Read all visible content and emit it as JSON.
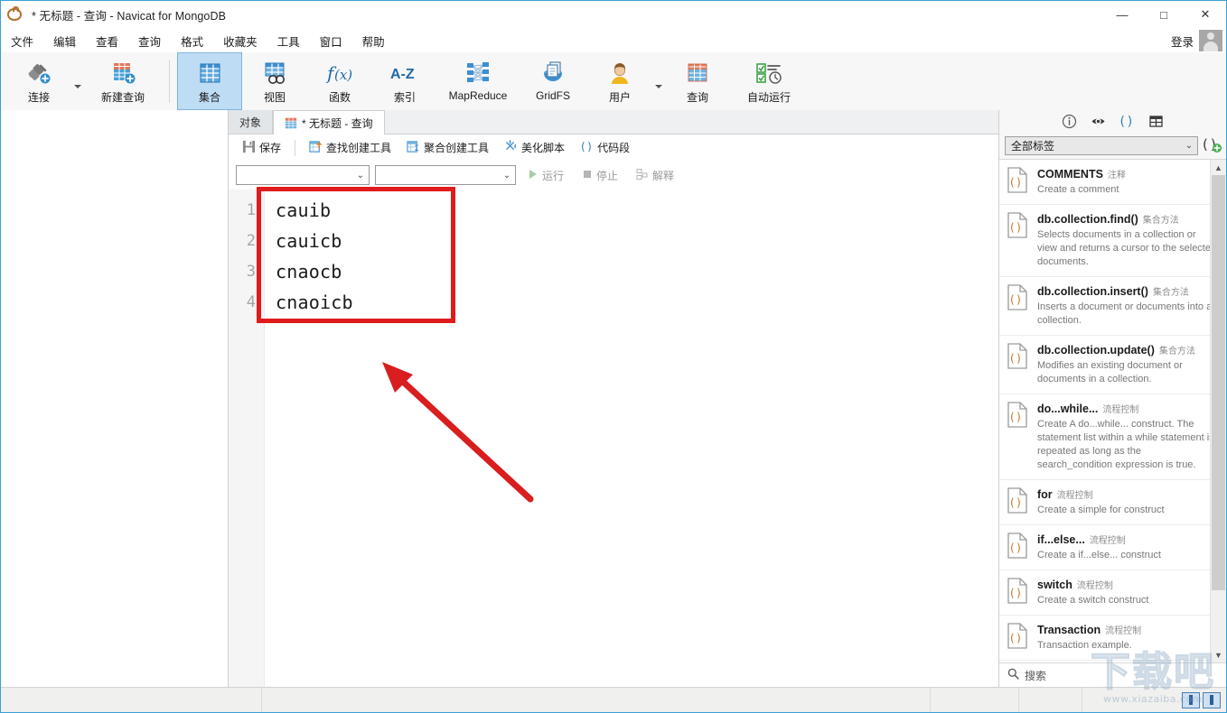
{
  "window": {
    "title": "* 无标题 - 查询 - Navicat for MongoDB",
    "logo_icon": "navicat-logo-icon",
    "minimize": "—",
    "maximize": "□",
    "close": "✕"
  },
  "menubar": {
    "items": [
      {
        "label": "文件",
        "name": "menu-file"
      },
      {
        "label": "编辑",
        "name": "menu-edit"
      },
      {
        "label": "查看",
        "name": "menu-view"
      },
      {
        "label": "查询",
        "name": "menu-query"
      },
      {
        "label": "格式",
        "name": "menu-format"
      },
      {
        "label": "收藏夹",
        "name": "menu-favorites"
      },
      {
        "label": "工具",
        "name": "menu-tools"
      },
      {
        "label": "窗口",
        "name": "menu-window"
      },
      {
        "label": "帮助",
        "name": "menu-help"
      }
    ],
    "login_label": "登录",
    "avatar_icon": "avatar-icon"
  },
  "toolbar": {
    "groups": [
      {
        "buttons": [
          {
            "label": "连接",
            "icon": "connection-icon",
            "name": "toolbar-connection",
            "caret": true,
            "active": false
          },
          {
            "label": "新建查询",
            "icon": "new-query-icon",
            "name": "toolbar-new-query",
            "caret": false,
            "active": false
          }
        ]
      },
      {
        "buttons": [
          {
            "label": "集合",
            "icon": "collection-icon",
            "name": "toolbar-collection",
            "caret": false,
            "active": true
          },
          {
            "label": "视图",
            "icon": "view-icon",
            "name": "toolbar-view",
            "caret": false,
            "active": false
          },
          {
            "label": "函数",
            "icon": "function-icon",
            "name": "toolbar-function",
            "caret": false,
            "active": false
          },
          {
            "label": "索引",
            "icon": "index-icon",
            "name": "toolbar-index",
            "caret": false,
            "active": false
          },
          {
            "label": "MapReduce",
            "icon": "mapreduce-icon",
            "name": "toolbar-mapreduce",
            "caret": false,
            "active": false
          },
          {
            "label": "GridFS",
            "icon": "gridfs-icon",
            "name": "toolbar-gridfs",
            "caret": false,
            "active": false
          },
          {
            "label": "用户",
            "icon": "user-icon",
            "name": "toolbar-user",
            "caret": true,
            "active": false
          },
          {
            "label": "查询",
            "icon": "query-icon",
            "name": "toolbar-query",
            "caret": false,
            "active": false
          },
          {
            "label": "自动运行",
            "icon": "automation-icon",
            "name": "toolbar-automation",
            "caret": false,
            "active": false
          }
        ]
      }
    ]
  },
  "tabs": [
    {
      "label": "对象",
      "name": "tab-objects",
      "active": false,
      "icon": null
    },
    {
      "label": "* 无标题 - 查询",
      "name": "tab-untitled-query",
      "active": true,
      "icon": "query-tab-icon"
    }
  ],
  "query_toolbar": {
    "items": [
      {
        "label": "保存",
        "icon": "save-icon",
        "name": "save-button",
        "disabled": false,
        "sep_after": true
      },
      {
        "label": "查找创建工具",
        "icon": "find-builder-icon",
        "name": "find-builder-button",
        "disabled": false,
        "sep_after": false
      },
      {
        "label": "聚合创建工具",
        "icon": "aggregate-builder-icon",
        "name": "aggregate-builder-button",
        "disabled": false,
        "sep_after": false
      },
      {
        "label": "美化脚本",
        "icon": "beautify-icon",
        "name": "beautify-script-button",
        "disabled": false,
        "sep_after": false
      },
      {
        "label": "代码段",
        "icon": "snippet-icon",
        "name": "code-snippet-button",
        "disabled": false,
        "sep_after": false
      }
    ],
    "run_items": [
      {
        "label": "运行",
        "icon": "run-icon",
        "name": "run-button"
      },
      {
        "label": "停止",
        "icon": "stop-icon",
        "name": "stop-button"
      },
      {
        "label": "解释",
        "icon": "explain-icon",
        "name": "explain-button"
      }
    ]
  },
  "combos": [
    {
      "value": "",
      "placeholder": "",
      "name": "connection-select"
    },
    {
      "value": "",
      "placeholder": "",
      "name": "database-select"
    }
  ],
  "editor": {
    "lines": [
      {
        "number": "1",
        "text": "cauib"
      },
      {
        "number": "2",
        "text": "cauicb"
      },
      {
        "number": "3",
        "text": "cnaocb"
      },
      {
        "number": "4",
        "text": "cnaoicb"
      }
    ]
  },
  "annotations": {
    "box_color": "#e01b1b",
    "arrow_color": "#d81e1e"
  },
  "right_panel": {
    "icons": [
      {
        "name": "info-icon",
        "glyph": "ⓘ",
        "active": false
      },
      {
        "name": "eye-icon",
        "glyph": "◉",
        "active": false
      },
      {
        "name": "code-snippet-icon",
        "glyph": "( )",
        "active": true
      },
      {
        "name": "table-grid-icon",
        "glyph": "▦",
        "active": false
      }
    ],
    "filter_label": "全部标签",
    "add_snippet_icon": "add-snippet-icon",
    "snippets": [
      {
        "title": "COMMENTS",
        "category": "注释",
        "desc": "Create a comment"
      },
      {
        "title": "db.collection.find()",
        "category": "集合方法",
        "desc": "Selects documents in a collection or view and returns a cursor to the selected documents."
      },
      {
        "title": "db.collection.insert()",
        "category": "集合方法",
        "desc": "Inserts a document or documents into a collection."
      },
      {
        "title": "db.collection.update()",
        "category": "集合方法",
        "desc": "Modifies an existing document or documents in a collection."
      },
      {
        "title": "do...while...",
        "category": "流程控制",
        "desc": "Create A do...while... construct. The statement list within a while statement is repeated as long as the search_condition expression is true."
      },
      {
        "title": "for",
        "category": "流程控制",
        "desc": "Create a simple for construct"
      },
      {
        "title": "if...else...",
        "category": "流程控制",
        "desc": "Create a if...else... construct"
      },
      {
        "title": "switch",
        "category": "流程控制",
        "desc": "Create a switch construct"
      },
      {
        "title": "Transaction",
        "category": "流程控制",
        "desc": "Transaction example."
      }
    ],
    "search_placeholder": "搜索",
    "search_icon": "search-icon",
    "scroll_up_icon": "chevron-up-icon",
    "scroll_down_icon": "chevron-down-icon"
  },
  "statusbar": {
    "text": "",
    "view_buttons": [
      {
        "name": "grid-view-button"
      },
      {
        "name": "form-view-button"
      }
    ]
  },
  "watermark": {
    "big": "下载吧",
    "url": "www.xiazaiba.com"
  }
}
